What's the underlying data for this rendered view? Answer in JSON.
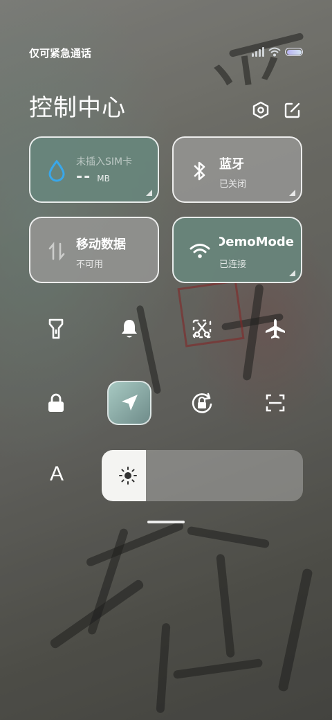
{
  "status_bar": {
    "carrier_text": "仅可紧急通话",
    "battery_level": 1.0
  },
  "header": {
    "title": "控制中心",
    "settings_icon": "settings-hexagon-icon",
    "edit_icon": "edit-icon"
  },
  "tiles": {
    "data_usage": {
      "label": "未插入SIM卡",
      "value": "--",
      "unit": "MB",
      "icon": "water-drop-icon",
      "state": "active"
    },
    "bluetooth": {
      "label": "蓝牙",
      "status": "已关闭",
      "icon": "bluetooth-icon",
      "state": "inactive"
    },
    "mobile_data": {
      "label": "移动数据",
      "status": "不可用",
      "icon": "mobile-data-icon",
      "state": "inactive"
    },
    "wifi": {
      "label": "DemoMode",
      "status": "已连接",
      "icon": "wifi-icon",
      "state": "active"
    }
  },
  "toggles": [
    {
      "name": "flashlight",
      "icon": "flashlight-icon"
    },
    {
      "name": "notification",
      "icon": "bell-icon"
    },
    {
      "name": "screenshot",
      "icon": "scissors-icon"
    },
    {
      "name": "airplane",
      "icon": "airplane-icon"
    },
    {
      "name": "lock",
      "icon": "lock-icon"
    },
    {
      "name": "location",
      "icon": "location-arrow-icon",
      "active": true
    },
    {
      "name": "rotation_lock",
      "icon": "rotation-lock-icon"
    },
    {
      "name": "scanner",
      "icon": "scan-icon"
    }
  ],
  "font_button": {
    "label": "A"
  },
  "brightness": {
    "level": 0.22,
    "icon": "sun-icon"
  },
  "colors": {
    "active_tile": "#68867c",
    "inactive_tile": "#949492",
    "accent_blue": "#39a7ea"
  }
}
